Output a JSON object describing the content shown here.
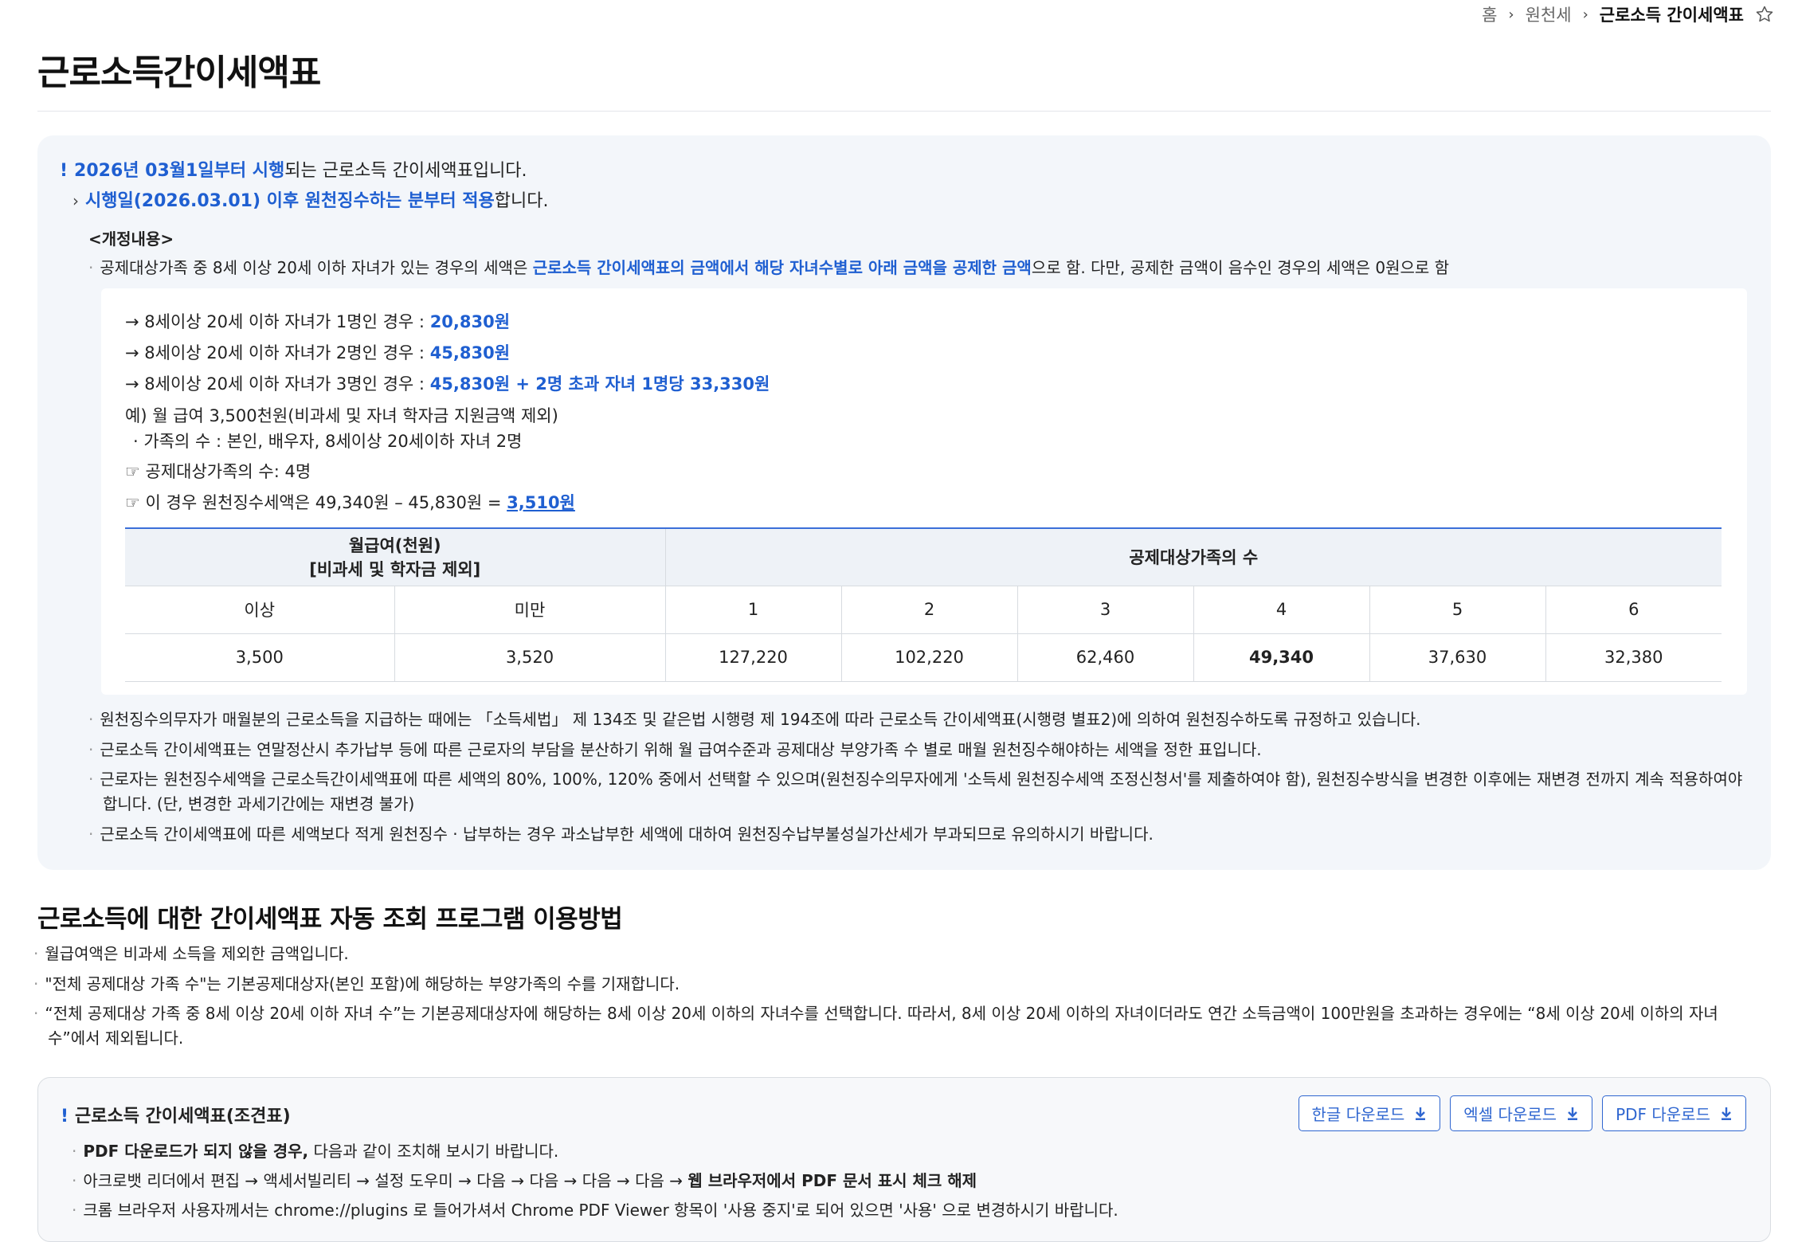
{
  "breadcrumb": {
    "home": "홈",
    "level1": "원천세",
    "current": "근로소득 간이세액표",
    "favorite_icon": "star-outline-icon"
  },
  "page_title": "근로소득간이세액표",
  "notice": {
    "line1_highlight": "2026년 03월1일부터 시행",
    "line1_rest": "되는 근로소득 간이세액표입니다.",
    "line2_highlight": "시행일(2026.03.01) 이후 원천징수하는 분부터 적용",
    "line2_rest": "합니다.",
    "revision_heading": "<개정내용>",
    "revision_text_a": "공제대상가족 중 8세 이상 20세 이하 자녀가 있는 경우의 세액은 ",
    "revision_highlight": "근로소득 간이세액표의 금액에서 해당 자녀수별로 아래 금액을 공제한 금액",
    "revision_text_b": "으로 함. 다만, 공제한 금액이 음수인 경우의 세액은 0원으로 함",
    "deductions": [
      {
        "label": "→ 8세이상 20세 이하 자녀가 1명인 경우 : ",
        "amount": "20,830원"
      },
      {
        "label": "→ 8세이상 20세 이하 자녀가 2명인 경우 : ",
        "amount": "45,830원"
      },
      {
        "label": "→ 8세이상 20세 이하 자녀가 3명인 경우 : ",
        "amount": "45,830원 + 2명 초과 자녀 1명당 33,330원"
      }
    ],
    "example_salary": "예) 월 급여 3,500천원(비과세 및 자녀 학자금 지원금액 제외)",
    "example_family": "· 가족의 수 : 본인, 배우자, 8세이상 20세이하 자녀 2명",
    "example_count": "☞ 공제대상가족의 수: 4명",
    "example_result_text": "☞ 이 경우 원천징수세액은 49,340원 – 45,830원 = ",
    "example_result_value": "3,510원",
    "table": {
      "header_salary": "월급여(천원)",
      "header_salary_note": "[비과세 및 학자금 제외]",
      "header_family": "공제대상가족의 수",
      "sub_headers": [
        "이상",
        "미만",
        "1",
        "2",
        "3",
        "4",
        "5",
        "6"
      ],
      "row": [
        "3,500",
        "3,520",
        "127,220",
        "102,220",
        "62,460",
        "49,340",
        "37,630",
        "32,380"
      ]
    },
    "bullets": [
      "원천징수의무자가 매월분의 근로소득을 지급하는 때에는 「소득세법」 제 134조 및 같은법 시행령 제 194조에 따라 근로소득 간이세액표(시행령 별표2)에 의하여 원천징수하도록 규정하고 있습니다.",
      "근로소득 간이세액표는 연말정산시 추가납부 등에 따른 근로자의 부담을 분산하기 위해 월 급여수준과 공제대상 부양가족 수 별로 매월 원천징수해야하는 세액을 정한 표입니다.",
      "근로자는 원천징수세액을 근로소득간이세액표에 따른 세액의 80%, 100%, 120% 중에서 선택할 수 있으며(원천징수의무자에게 '소득세 원천징수세액 조정신청서'를 제출하여야 함), 원천징수방식을 변경한 이후에는 재변경 전까지 계속 적용하여야 합니다. (단, 변경한 과세기간에는 재변경 불가)",
      "근로소득 간이세액표에 따른 세액보다 적게 원천징수 · 납부하는 경우 과소납부한 세액에 대하여 원천징수납부불성실가산세가 부과되므로 유의하시기 바랍니다."
    ]
  },
  "section2": {
    "title": "근로소득에 대한 간이세액표 자동 조회 프로그램 이용방법",
    "bullets": [
      "월급여액은  비과세 소득을 제외한 금액입니다.",
      "\"전체 공제대상 가족 수\"는 기본공제대상자(본인 포함)에 해당하는 부양가족의 수를 기재합니다.",
      "“전체 공제대상 가족 중 8세 이상 20세 이하 자녀 수”는 기본공제대상자에 해당하는 8세 이상 20세 이하의 자녀수를 선택합니다. 따라서, 8세 이상 20세 이하의 자녀이더라도 연간 소득금액이 100만원을 초과하는 경우에는 “8세 이상 20세 이하의 자녀수”에서 제외됩니다."
    ]
  },
  "download": {
    "title": "근로소득 간이세액표(조견표)",
    "buttons": [
      "한글 다운로드",
      "엑셀 다운로드",
      "PDF 다운로드"
    ],
    "button_icon": "download-icon",
    "line1_bold": "PDF 다운로드가 되지 않을 경우,",
    "line1_rest": " 다음과 같이 조치해 보시기 바랍니다.",
    "line2_text": "아크로뱃 리더에서 편집 → 액세서빌리티 → 설정 도우미 → 다음 → 다음 → 다음 → 다음 → ",
    "line2_bold": "웹 브라우저에서 PDF 문서 표시 체크 해제",
    "line3": "크롬 브라우저 사용자께서는 chrome://plugins 로 들어가셔서 Chrome PDF Viewer 항목이 '사용 중지'로 되어 있으면 '사용' 으로 변경하시기 바랍니다."
  },
  "colors": {
    "accent_blue": "#1f5fd1",
    "notice_bg": "#f3f6fa",
    "table_header_bg": "#eef2f7"
  }
}
